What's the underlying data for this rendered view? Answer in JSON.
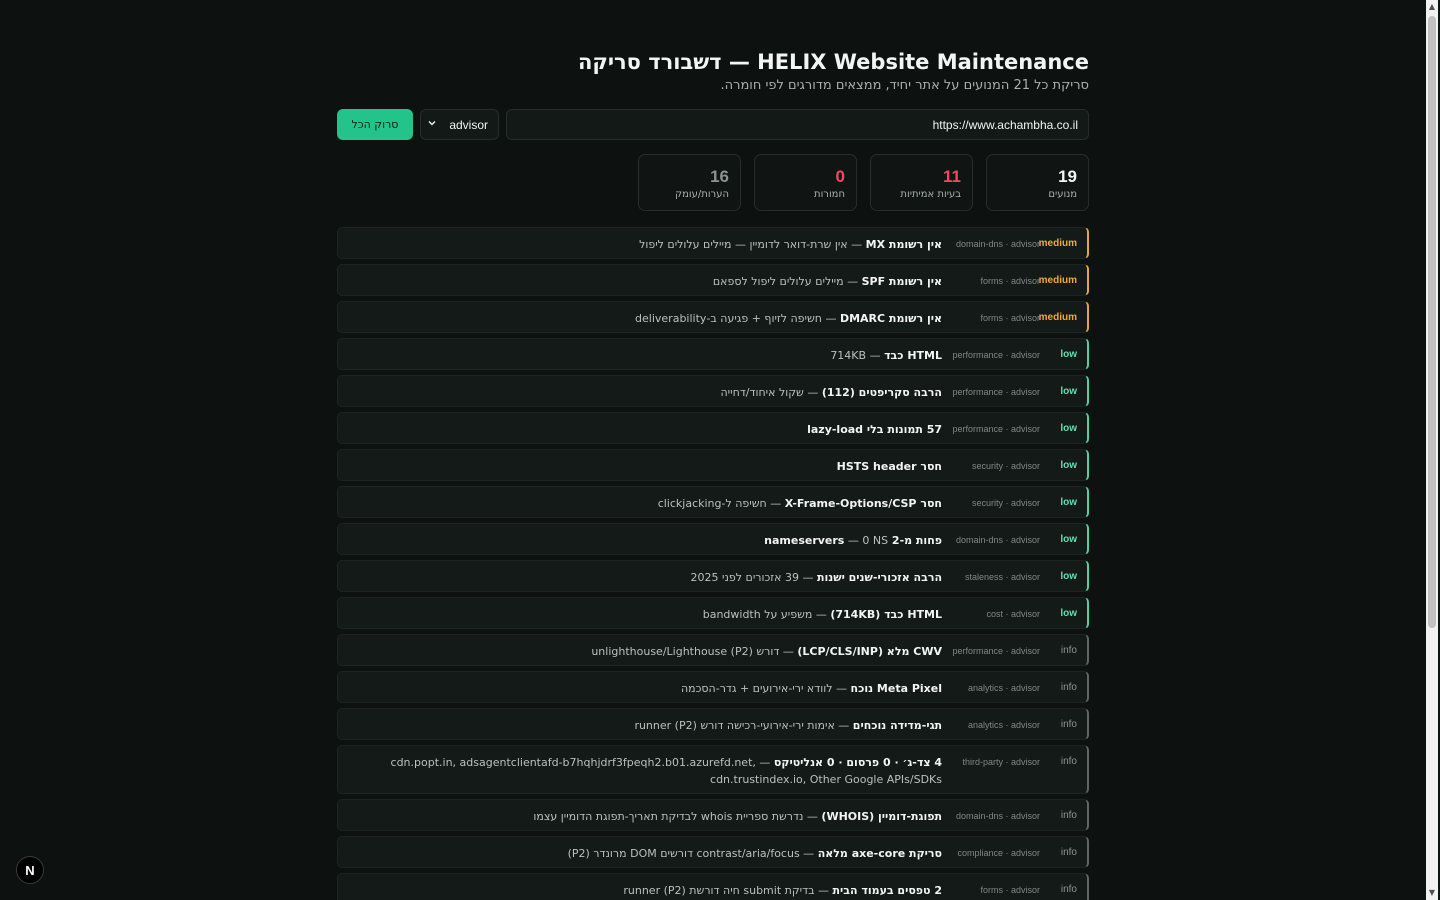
{
  "header": {
    "title": "HELIX Website Maintenance — דשבורד סריקה",
    "subtitle": "סריקת כל 21 המנועים על אתר יחיד, ממצאים מדורגים לפי חומרה."
  },
  "controls": {
    "url_value": "https://www.achambha.co.il",
    "mode_value": "advisor",
    "scan_label": "סרוק הכל"
  },
  "stats": [
    {
      "value": "19",
      "label": "מנועים",
      "color": "#f3f5f4"
    },
    {
      "value": "11",
      "label": "בעיות אמיתיות",
      "color": "#f5475f"
    },
    {
      "value": "0",
      "label": "חמורות",
      "color": "#f5475f"
    },
    {
      "value": "16",
      "label": "הערות/עומק",
      "color": "#8a9390"
    }
  ],
  "findings": [
    {
      "severity": "medium",
      "category": "domain-dns · advisor",
      "title": "אין רשומת MX",
      "detail": " — אין שרת-דואר לדומיין — מיילים עלולים ליפול"
    },
    {
      "severity": "medium",
      "category": "forms · advisor",
      "title": "אין רשומת SPF",
      "detail": " — מיילים עלולים ליפול לספאם"
    },
    {
      "severity": "medium",
      "category": "forms · advisor",
      "title": "אין רשומת DMARC",
      "detail": " — חשיפה לזיוף + פגיעה ב-deliverability"
    },
    {
      "severity": "low",
      "category": "performance · advisor",
      "title": "HTML כבד",
      "detail": " — 714KB"
    },
    {
      "severity": "low",
      "category": "performance · advisor",
      "title": "הרבה סקריפטים (112)",
      "detail": " — שקול איחוד/דחייה"
    },
    {
      "severity": "low",
      "category": "performance · advisor",
      "title": "57 תמונות בלי lazy-load",
      "detail": ""
    },
    {
      "severity": "low",
      "category": "security · advisor",
      "title": "חסר HSTS header",
      "detail": ""
    },
    {
      "severity": "low",
      "category": "security · advisor",
      "title": "חסר X-Frame-Options/CSP",
      "detail": " — חשיפה ל-clickjacking"
    },
    {
      "severity": "low",
      "category": "domain-dns · advisor",
      "title": "פחות מ-2 nameservers",
      "detail": " — 0 NS"
    },
    {
      "severity": "low",
      "category": "staleness · advisor",
      "title": "הרבה אזכורי-שנים ישנות",
      "detail": " — 39 אזכורים לפני 2025"
    },
    {
      "severity": "low",
      "category": "cost · advisor",
      "title": "HTML כבד (714KB)",
      "detail": " — משפיע על bandwidth"
    },
    {
      "severity": "info",
      "category": "performance · advisor",
      "title": "CWV מלא (LCP/CLS/INP)",
      "detail": " — דורש unlighthouse/Lighthouse (P2)"
    },
    {
      "severity": "info",
      "category": "analytics · advisor",
      "title": "Meta Pixel נוכח",
      "detail": " — לוודא ירי-אירועים + גדר-הסכמה"
    },
    {
      "severity": "info",
      "category": "analytics · advisor",
      "title": "תגי-מדידה נוכחים",
      "detail": " — אימות ירי-אירועי-רכישה דורש runner (P2)"
    },
    {
      "severity": "info",
      "category": "third-party · advisor",
      "title": "4 צד-ג׳ · 0 פרסום · 0 אנליטיקס",
      "detail": " — cdn.popt.in, adsagentclientafd-b7hqhjdrf3fpeqh2.b01.azurefd.net, cdn.trustindex.io, Other Google APIs/SDKs",
      "multi": true
    },
    {
      "severity": "info",
      "category": "domain-dns · advisor",
      "title": "תפוגת-דומיין (WHOIS)",
      "detail": " — נדרשת ספריית whois לבדיקת תאריך-תפוגת הדומיין עצמו"
    },
    {
      "severity": "info",
      "category": "compliance · advisor",
      "title": "סריקת axe-core מלאה",
      "detail": " — contrast/aria/focus דורשים DOM מרונדר (P2)"
    },
    {
      "severity": "info",
      "category": "forms · advisor",
      "title": "2 טפסים בעמוד הבית",
      "detail": " — בדיקת submit חיה דורשת runner (P2)"
    }
  ],
  "badge": {
    "letter": "N"
  }
}
